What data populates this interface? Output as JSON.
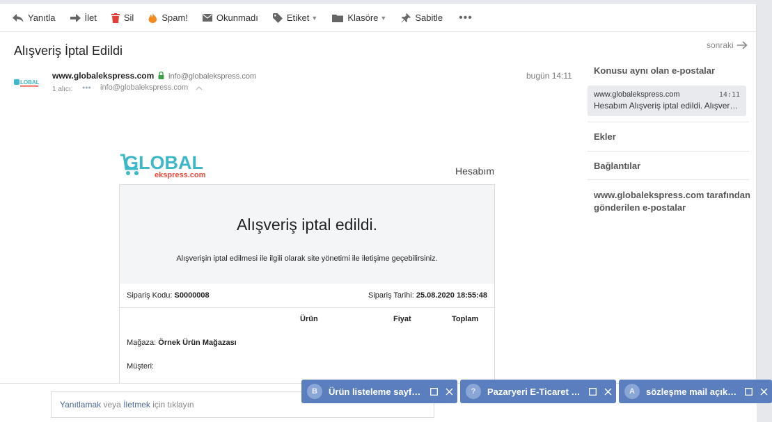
{
  "toolbar": {
    "reply": "Yanıtla",
    "forward": "İlet",
    "delete": "Sil",
    "spam": "Spam!",
    "unread": "Okunmadı",
    "label": "Etiket",
    "folder": "Klasöre",
    "pin": "Sabitle",
    "more": "•••"
  },
  "mail": {
    "subject": "Alışveriş İptal Edildi",
    "sender_name": "www.globalekspress.com",
    "sender_email": "info@globalekspress.com",
    "recipients_label": "1 alıcı:",
    "recipient_email": "info@globalekspress.com",
    "time": "bugün 14:11",
    "next": "sonraki"
  },
  "body": {
    "brand_main": "GLOBAL",
    "brand_sub": "ekspress.com",
    "account_link": "Hesabım",
    "title": "Alışveriş iptal edildi.",
    "description": "Alışverişin iptal edilmesi ile ilgili olarak site yönetimi ile iletişime geçebilirsiniz.",
    "order_code_label": "Sipariş Kodu:",
    "order_code": "S0000008",
    "order_date_label": "Sipariş Tarihi:",
    "order_date": "25.08.2020 18:55:48",
    "columns": [
      "Ürün",
      "Fiyat",
      "Toplam"
    ],
    "store_label": "Mağaza:",
    "store_name": "Örnek Ürün Mağazası",
    "customer_label": "Müşteri:"
  },
  "reply": {
    "reply_link": "Yanıtlamak",
    "or": "veya",
    "forward_link": "İletmek",
    "suffix": "için tıklayın"
  },
  "sidebar": {
    "same_subject": "Konusu aynı olan e-postalar",
    "thread_from": "www.globalekspress.com",
    "thread_time": "14:11",
    "thread_snippet": "Hesabım Alışveriş iptal edildi. Alışverişin iptal edilmesi",
    "attachments": "Ekler",
    "links": "Bağlantılar",
    "sent_by_line1": "www.globalekspress.com tarafından",
    "sent_by_line2": "gönderilen e-postalar"
  },
  "chips": [
    {
      "initial": "B",
      "title": "Ürün listeleme sayfası hakkında"
    },
    {
      "initial": "?",
      "title": "Pazaryeri E-Ticaret Sistemi"
    },
    {
      "initial": "A",
      "title": "sözleşme mail açıklaması"
    }
  ],
  "colors": {
    "chip_bg": "#5b7fbe",
    "delete_red": "#e0403a",
    "spam_orange": "#f28a1e",
    "brand_teal": "#3cb8c8",
    "brand_red": "#e84a3c",
    "lock_green": "#3aa24a"
  }
}
